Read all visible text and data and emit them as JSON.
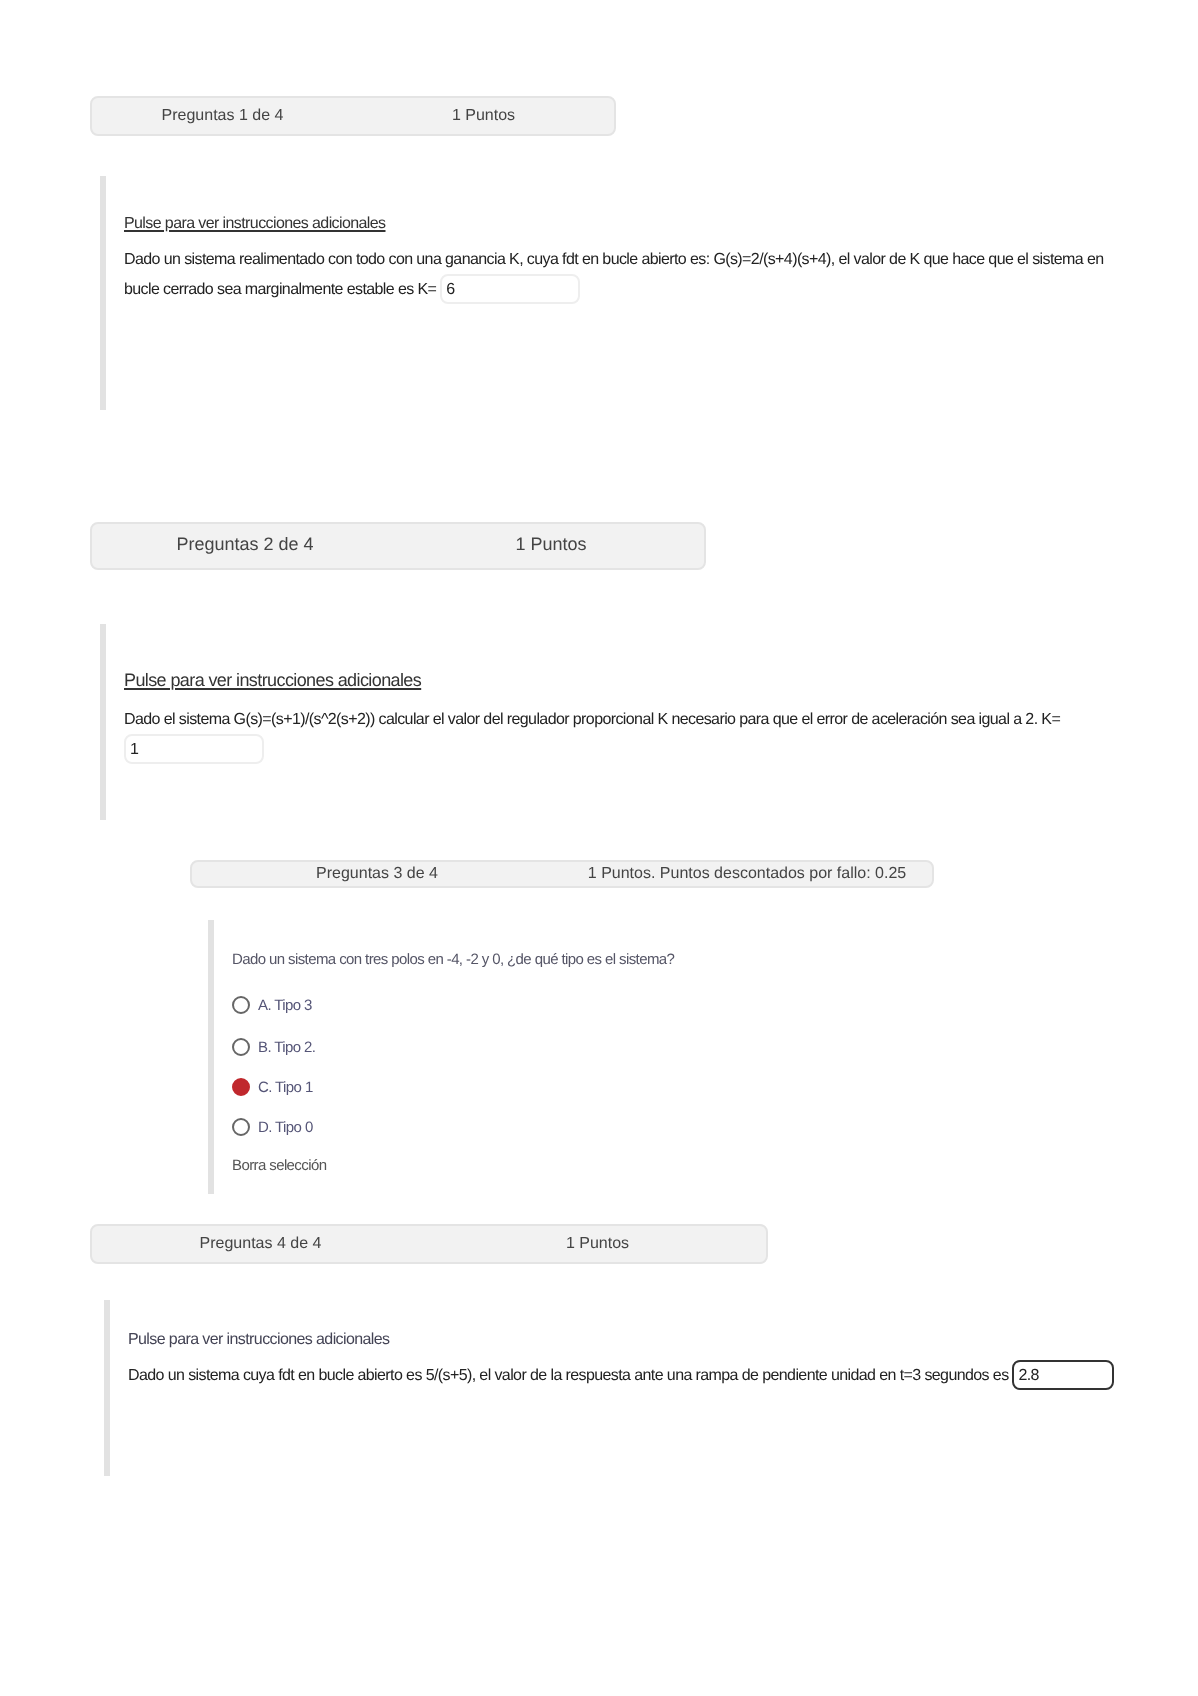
{
  "questions": [
    {
      "kind": "fill",
      "number": "Preguntas 1 de 4",
      "points": "1 Puntos",
      "link": "Pulse para ver instrucciones adicionales",
      "text": "Dado un sistema realimentado con todo con una ganancia K, cuya fdt en bucle abierto es: G(s)=2/(s+4)(s+4), el valor de K que hace que el sistema en bucle cerrado sea marginalmente estable es K=",
      "answer": "6"
    },
    {
      "kind": "fill",
      "number": "Preguntas 2 de 4",
      "points": "1 Puntos",
      "link": "Pulse para ver instrucciones adicionales",
      "text": "Dado el sistema G(s)=(s+1)/(s^2(s+2)) calcular el valor del regulador proporcional K necesario para que el error de aceleración sea igual a 2. K=",
      "answer": "1"
    },
    {
      "kind": "choice",
      "number": "Preguntas 3 de 4",
      "points": "1 Puntos. Puntos descontados por fallo: 0.25",
      "text": "Dado un sistema con tres polos en -4, -2 y 0, ¿de qué tipo es el sistema?",
      "options": [
        {
          "label": "A. Tipo 3",
          "selected": false
        },
        {
          "label": "B. Tipo 2.",
          "selected": false
        },
        {
          "label": "C. Tipo 1",
          "selected": true
        },
        {
          "label": "D. Tipo 0",
          "selected": false
        }
      ],
      "clear": "Borra selección"
    },
    {
      "kind": "fill",
      "number": "Preguntas 4 de 4",
      "points": "1 Puntos",
      "link": "Pulse para ver instrucciones adicionales",
      "text": "Dado un sistema cuya fdt en bucle abierto es 5/(s+5), el valor de la respuesta ante una rampa de pendiente unidad en t=3 segundos es",
      "answer": "2.8"
    }
  ]
}
